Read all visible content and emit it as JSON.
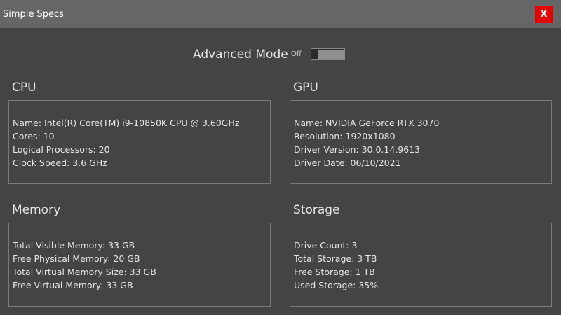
{
  "window": {
    "title": "Simple Specs",
    "close_label": "X"
  },
  "mode": {
    "label": "Advanced Mode",
    "toggle_state": "Off"
  },
  "cpu": {
    "title": "CPU",
    "lines": [
      "Name: Intel(R) Core(TM) i9-10850K CPU @ 3.60GHz",
      "Cores: 10",
      "Logical Processors: 20",
      "Clock Speed: 3.6 GHz"
    ]
  },
  "gpu": {
    "title": "GPU",
    "lines": [
      "Name: NVIDIA GeForce RTX 3070",
      "Resolution: 1920x1080",
      "Driver Version: 30.0.14.9613",
      "Driver Date: 06/10/2021"
    ]
  },
  "memory": {
    "title": "Memory",
    "lines": [
      "Total Visible Memory: 33 GB",
      "Free Physical Memory: 20 GB",
      "Total Virtual Memory Size: 33 GB",
      "Free Virtual Memory: 33 GB"
    ]
  },
  "storage": {
    "title": "Storage",
    "lines": [
      "Drive Count: 3",
      "Total Storage: 3 TB",
      "Free Storage: 1 TB",
      "Used Storage: 35%"
    ]
  },
  "colors": {
    "background": "#444444",
    "titlebar": "#666666",
    "close_button": "#e60000",
    "panel_border": "#7a7a7a",
    "toggle_track": "#909090"
  }
}
